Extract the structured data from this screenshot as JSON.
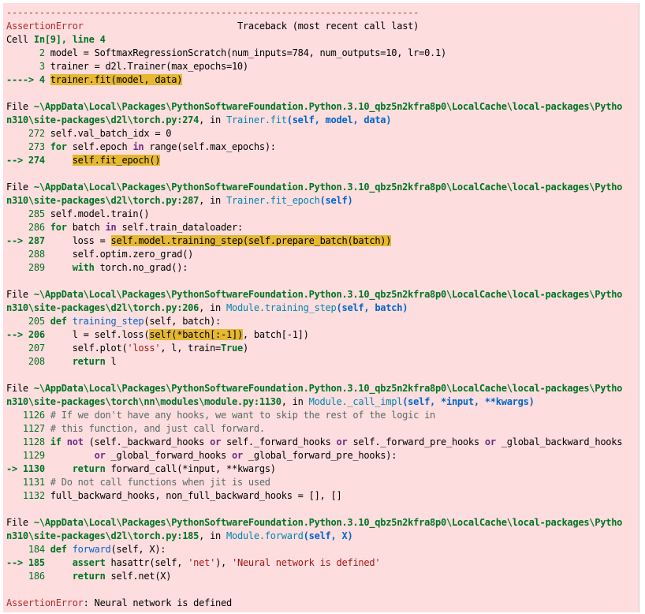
{
  "traceback": {
    "separator": "---------------------------------------------------------------------------",
    "error_name": "AssertionError",
    "header_right": "Traceback (most recent call last)",
    "cell_prefix": "Cell ",
    "cell_ref": "In[9], line 4",
    "cell_lines": [
      {
        "num": "      2 ",
        "code": "model = SoftmaxRegressionScratch(num_inputs=784, num_outputs=10, lr=0.1)"
      },
      {
        "num": "      3 ",
        "code": "trainer = d2l.Trainer(max_epochs=10)"
      }
    ],
    "cell_arrow": "----> 4 ",
    "cell_arrow_code": "trainer.fit(model, data)",
    "file_prefix": "File ",
    "path_a": "~\\AppData\\Local\\Packages\\PythonSoftwareFoundation.Python.3.10_qbz5n2kfra8p0\\LocalCache\\local-packages\\Pytho",
    "path_b_torch": "n310\\site-packages\\d2l\\torch.py",
    "path_b_module": "n310\\site-packages\\torch\\nn\\modules\\module.py",
    "in_word": ", in ",
    "frame1": {
      "loc": ":274",
      "func": "Trainer.fit",
      "args": "(self, model, data)",
      "lines": [
        {
          "num": "    272 ",
          "code": "self.val_batch_idx = 0"
        },
        {
          "num": "    273 ",
          "kw": "for",
          "code": " self.epoch ",
          "kw2": "in",
          "code2": " range(self.max_epochs):"
        }
      ],
      "arrow": "--> 274 ",
      "indent": "    ",
      "arrow_code": "self.fit_epoch()"
    },
    "frame2": {
      "loc": ":287",
      "func": "Trainer.fit_epoch",
      "args": "(self)",
      "line285": {
        "num": "    285 ",
        "code": "self.model.train()"
      },
      "line286": {
        "num": "    286 ",
        "kw": "for",
        "code": " batch ",
        "kw2": "in",
        "code2": " self.train_dataloader:"
      },
      "arrow": "--> 287 ",
      "arrow_pre": "    loss = ",
      "arrow_code": "self.model.training_step(self.prepare_batch(batch))",
      "line288": {
        "num": "    288 ",
        "code": "    self.optim.zero_grad()"
      },
      "line289": {
        "num": "    289 ",
        "indent": "    ",
        "kw": "with",
        "code": " torch.no_grad():"
      }
    },
    "frame3": {
      "loc": ":206",
      "func": "Module.training_step",
      "args": "(self, batch)",
      "line205": {
        "num": "    205 ",
        "kw": "def",
        "fn": " training_step",
        "code": "(self, batch):"
      },
      "arrow": "--> 206 ",
      "arrow_pre": "    l = self.loss(",
      "arrow_code": "self(*batch[:-1])",
      "arrow_post": ", batch[-1])",
      "line207": {
        "num": "    207 ",
        "code": "    self.plot(",
        "str": "'loss'",
        "code2": ", l, train=",
        "kw": "True",
        "code3": ")"
      },
      "line208": {
        "num": "    208 ",
        "indent": "    ",
        "kw": "return",
        "code": " l"
      }
    },
    "frame4": {
      "loc": ":1130",
      "func": "Module._call_impl",
      "args": "(self, *input, **kwargs)",
      "line1126": {
        "num": "   1126 ",
        "cmt": "# If we don't have any hooks, we want to skip the rest of the logic in"
      },
      "line1127": {
        "num": "   1127 ",
        "cmt": "# this function, and just call forward."
      },
      "line1128": {
        "num": "   1128 ",
        "kw": "if",
        "sp": " ",
        "not": "not",
        "code": " (self._backward_hooks ",
        "or1": "or",
        "code2": " self._forward_hooks ",
        "or2": "or",
        "code3": " self._forward_pre_hooks ",
        "or3": "or",
        "code4": " _global_backward_hooks"
      },
      "line1129": {
        "num": "   1129 ",
        "indent": "        ",
        "or1": "or",
        "code": " _global_forward_hooks ",
        "or2": "or",
        "code2": " _global_forward_pre_hooks):"
      },
      "arrow": "-> 1130 ",
      "indent": "    ",
      "arrow_kw": "return",
      "arrow_code": " forward_call(*input, **kwargs)",
      "line1131": {
        "num": "   1131 ",
        "cmt": "# Do not call functions when jit is used"
      },
      "line1132": {
        "num": "   1132 ",
        "code": "full_backward_hooks, non_full_backward_hooks = [], []"
      }
    },
    "frame5": {
      "loc": ":185",
      "func": "Module.forward",
      "args": "(self, X)",
      "line184": {
        "num": "    184 ",
        "kw": "def",
        "fn": " forward",
        "code": "(self, X):"
      },
      "arrow": "--> 185 ",
      "indent": "    ",
      "arrow_kw": "assert",
      "arrow_code": " hasattr(self, ",
      "arrow_str": "'net'",
      "arrow_code2": "), ",
      "arrow_str2": "'Neural network is defined'",
      "line186": {
        "num": "    186 ",
        "indent": "    ",
        "kw": "return",
        "code": " self.net(X)"
      }
    },
    "final_error": "AssertionError",
    "final_message": ": Neural network is defined"
  },
  "colors": {
    "background": "#fddddd",
    "highlight": "#e5b830",
    "error_red": "#b22b31",
    "path_green": "#007427",
    "func_cyan": "#0086b3"
  }
}
